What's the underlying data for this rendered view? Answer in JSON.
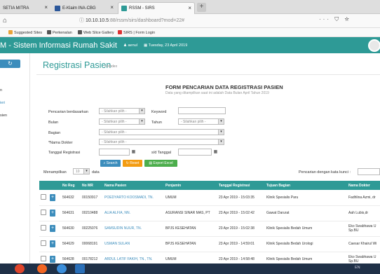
{
  "browser": {
    "tabs": [
      {
        "label": "SETIA MITRA",
        "color": "#777777"
      },
      {
        "label": "E-Klaim INA-CBG",
        "color": "#2b579a"
      },
      {
        "label": "RSSM - SIRS",
        "color": "#2e9a96"
      }
    ],
    "new_tab": "+",
    "url_host": "10.10.10.5",
    "url_path": ":88/rssm/sirs/dashboard?mod=22#",
    "bookmarks": [
      "Suggested Sites",
      "Perkenalan",
      "Web Slice Gallery",
      "SIRS | Form Login"
    ]
  },
  "app": {
    "title": "M - Sistem Informasi Rumah Sakit",
    "user": "aenul",
    "date": "Tuesday, 23 April 2019",
    "accent": "#2e9a96"
  },
  "sidebar": {
    "items": [
      "n",
      "ieri",
      "sien"
    ]
  },
  "page": {
    "title": "Registrasi Pasien",
    "subtitle": ">>Index"
  },
  "form": {
    "title": "FORM PENCARIAN DATA REGISTRASI PASIEN",
    "subtitle": "Data yang ditampilkan saat ini adalah Data Bulan April Tahun 2019",
    "labels": {
      "berdasarkan": "Pencarian berdasarkan",
      "keyword": "Keyword",
      "bulan": "Bulan",
      "tahun": "Tahun",
      "bagian": "Bagian",
      "dokter": "*Nama Dokter",
      "tanggal": "Tanggal Registrasi",
      "sd": "s/d Tanggal"
    },
    "select_placeholder": "- Silahkan pilih -",
    "buttons": {
      "search": "Search",
      "reset": "Reset",
      "export": "Export Excel"
    }
  },
  "table_controls": {
    "show_label": "Menampilkan",
    "show_value": "10",
    "data_label": "data",
    "search_label": "Pencarian dengan kata kunci :"
  },
  "table": {
    "columns": [
      "",
      "",
      "No Reg",
      "No MR",
      "Nama Pasien",
      "Penjamin",
      "Tanggal Registrasi",
      "Tujuan Bagian",
      "Nama Dokter"
    ],
    "rows": [
      {
        "no_reg": "564632",
        "no_mr": "00150917",
        "nama": "POEDYARTO KOOSMADI, TN.",
        "penjamin": "UMUM",
        "tanggal": "23 Apr 2019 - 15:03:35",
        "tujuan": "Klinik Spesialis Paru",
        "dokter": "Fadhlina Azmi, dr"
      },
      {
        "no_reg": "564631",
        "no_mr": "00210488",
        "nama": "ALIA ALFIA, NN.",
        "penjamin": "ASURANSI SINAR MAS, PT",
        "tanggal": "23 Apr 2019 - 15:02:42",
        "tujuan": "Gawat Darurat",
        "dokter": "Aah Lubis,dr"
      },
      {
        "no_reg": "564630",
        "no_mr": "00225076",
        "nama": "SAMSUDIN NUUR, TN.",
        "penjamin": "BPJS KESEHATAN",
        "tanggal": "23 Apr 2019 - 15:02:38",
        "tujuan": "Klinik Spesialis Bedah Umum",
        "dokter": "Eko Swabhawa U Sp.BU"
      },
      {
        "no_reg": "564629",
        "no_mr": "00068191",
        "nama": "USMAN SULAN",
        "penjamin": "BPJS KESEHATAN",
        "tanggal": "23 Apr 2019 - 14:59:01",
        "tujuan": "Klinik Spesialis Bedah Urologi",
        "dokter": "Caesar Khairul Wi"
      },
      {
        "no_reg": "564628",
        "no_mr": "00178212",
        "nama": "ABDUL LATIF FAKIH, TN., TN.",
        "penjamin": "UMUM",
        "tanggal": "23 Apr 2019 - 14:58:48",
        "tujuan": "Klinik Spesialis Bedah Umum",
        "dokter": "Eko Swabhawa U Sp.BU"
      }
    ]
  },
  "taskbar": {
    "tray": "EN"
  }
}
